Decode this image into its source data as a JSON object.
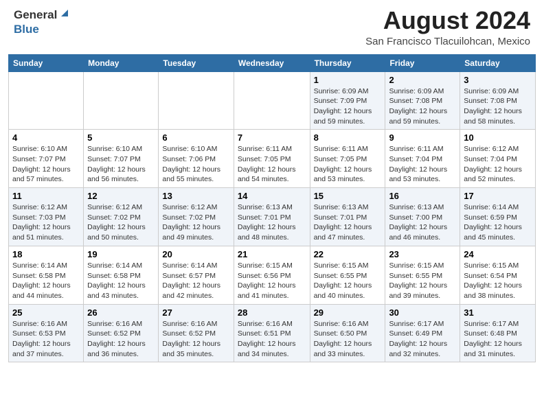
{
  "header": {
    "logo_general": "General",
    "logo_blue": "Blue",
    "main_title": "August 2024",
    "subtitle": "San Francisco Tlacuilohcan, Mexico"
  },
  "calendar": {
    "headers": [
      "Sunday",
      "Monday",
      "Tuesday",
      "Wednesday",
      "Thursday",
      "Friday",
      "Saturday"
    ],
    "weeks": [
      [
        {
          "day": "",
          "info": ""
        },
        {
          "day": "",
          "info": ""
        },
        {
          "day": "",
          "info": ""
        },
        {
          "day": "",
          "info": ""
        },
        {
          "day": "1",
          "info": "Sunrise: 6:09 AM\nSunset: 7:09 PM\nDaylight: 12 hours\nand 59 minutes."
        },
        {
          "day": "2",
          "info": "Sunrise: 6:09 AM\nSunset: 7:08 PM\nDaylight: 12 hours\nand 59 minutes."
        },
        {
          "day": "3",
          "info": "Sunrise: 6:09 AM\nSunset: 7:08 PM\nDaylight: 12 hours\nand 58 minutes."
        }
      ],
      [
        {
          "day": "4",
          "info": "Sunrise: 6:10 AM\nSunset: 7:07 PM\nDaylight: 12 hours\nand 57 minutes."
        },
        {
          "day": "5",
          "info": "Sunrise: 6:10 AM\nSunset: 7:07 PM\nDaylight: 12 hours\nand 56 minutes."
        },
        {
          "day": "6",
          "info": "Sunrise: 6:10 AM\nSunset: 7:06 PM\nDaylight: 12 hours\nand 55 minutes."
        },
        {
          "day": "7",
          "info": "Sunrise: 6:11 AM\nSunset: 7:05 PM\nDaylight: 12 hours\nand 54 minutes."
        },
        {
          "day": "8",
          "info": "Sunrise: 6:11 AM\nSunset: 7:05 PM\nDaylight: 12 hours\nand 53 minutes."
        },
        {
          "day": "9",
          "info": "Sunrise: 6:11 AM\nSunset: 7:04 PM\nDaylight: 12 hours\nand 53 minutes."
        },
        {
          "day": "10",
          "info": "Sunrise: 6:12 AM\nSunset: 7:04 PM\nDaylight: 12 hours\nand 52 minutes."
        }
      ],
      [
        {
          "day": "11",
          "info": "Sunrise: 6:12 AM\nSunset: 7:03 PM\nDaylight: 12 hours\nand 51 minutes."
        },
        {
          "day": "12",
          "info": "Sunrise: 6:12 AM\nSunset: 7:02 PM\nDaylight: 12 hours\nand 50 minutes."
        },
        {
          "day": "13",
          "info": "Sunrise: 6:12 AM\nSunset: 7:02 PM\nDaylight: 12 hours\nand 49 minutes."
        },
        {
          "day": "14",
          "info": "Sunrise: 6:13 AM\nSunset: 7:01 PM\nDaylight: 12 hours\nand 48 minutes."
        },
        {
          "day": "15",
          "info": "Sunrise: 6:13 AM\nSunset: 7:01 PM\nDaylight: 12 hours\nand 47 minutes."
        },
        {
          "day": "16",
          "info": "Sunrise: 6:13 AM\nSunset: 7:00 PM\nDaylight: 12 hours\nand 46 minutes."
        },
        {
          "day": "17",
          "info": "Sunrise: 6:14 AM\nSunset: 6:59 PM\nDaylight: 12 hours\nand 45 minutes."
        }
      ],
      [
        {
          "day": "18",
          "info": "Sunrise: 6:14 AM\nSunset: 6:58 PM\nDaylight: 12 hours\nand 44 minutes."
        },
        {
          "day": "19",
          "info": "Sunrise: 6:14 AM\nSunset: 6:58 PM\nDaylight: 12 hours\nand 43 minutes."
        },
        {
          "day": "20",
          "info": "Sunrise: 6:14 AM\nSunset: 6:57 PM\nDaylight: 12 hours\nand 42 minutes."
        },
        {
          "day": "21",
          "info": "Sunrise: 6:15 AM\nSunset: 6:56 PM\nDaylight: 12 hours\nand 41 minutes."
        },
        {
          "day": "22",
          "info": "Sunrise: 6:15 AM\nSunset: 6:55 PM\nDaylight: 12 hours\nand 40 minutes."
        },
        {
          "day": "23",
          "info": "Sunrise: 6:15 AM\nSunset: 6:55 PM\nDaylight: 12 hours\nand 39 minutes."
        },
        {
          "day": "24",
          "info": "Sunrise: 6:15 AM\nSunset: 6:54 PM\nDaylight: 12 hours\nand 38 minutes."
        }
      ],
      [
        {
          "day": "25",
          "info": "Sunrise: 6:16 AM\nSunset: 6:53 PM\nDaylight: 12 hours\nand 37 minutes."
        },
        {
          "day": "26",
          "info": "Sunrise: 6:16 AM\nSunset: 6:52 PM\nDaylight: 12 hours\nand 36 minutes."
        },
        {
          "day": "27",
          "info": "Sunrise: 6:16 AM\nSunset: 6:52 PM\nDaylight: 12 hours\nand 35 minutes."
        },
        {
          "day": "28",
          "info": "Sunrise: 6:16 AM\nSunset: 6:51 PM\nDaylight: 12 hours\nand 34 minutes."
        },
        {
          "day": "29",
          "info": "Sunrise: 6:16 AM\nSunset: 6:50 PM\nDaylight: 12 hours\nand 33 minutes."
        },
        {
          "day": "30",
          "info": "Sunrise: 6:17 AM\nSunset: 6:49 PM\nDaylight: 12 hours\nand 32 minutes."
        },
        {
          "day": "31",
          "info": "Sunrise: 6:17 AM\nSunset: 6:48 PM\nDaylight: 12 hours\nand 31 minutes."
        }
      ]
    ]
  }
}
